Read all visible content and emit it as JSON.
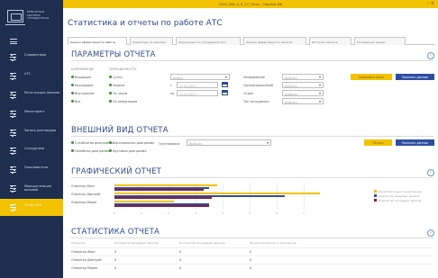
{
  "window": {
    "title": "2021_NW_4_0_27_T.exe - Сартма АФ",
    "controls": "– ×"
  },
  "sidebar": {
    "logo_text": "РЕМОНТНАЯ СИСТЕМА ГРАЖДАНСКАЯ",
    "items": [
      {
        "label": "Справочники"
      },
      {
        "label": "АТС"
      },
      {
        "label": "Регистрация звонков"
      },
      {
        "label": "Мониторинг"
      },
      {
        "label": "Запись разговоров"
      },
      {
        "label": "Сотрудники"
      },
      {
        "label": "Пользователи"
      },
      {
        "label": "Маршрутизация вызовов"
      },
      {
        "label": "Отчёт АТС"
      }
    ]
  },
  "page": {
    "title": "Статистика и отчеты по работе АТС",
    "tabs": [
      "Оценка эффективности работы",
      "Операторы по звонкам",
      "Загруженность сотрудников АТС",
      "Оценка эффективности звонков",
      "Источник звонков",
      "Потерянные звонки"
    ]
  },
  "params": {
    "title": "ПАРАМЕТРЫ ОТЧЕТА",
    "col1_header": "НАПРАВЛЕНИЕ",
    "col2_header": "ПЕРИОДИЧНОСТЬ",
    "col1_items": [
      "Входящие",
      "Исходящие",
      "Внутренние",
      "Все"
    ],
    "col2_items": [
      "Сутки",
      "Неделя",
      "По часам",
      "По операторам"
    ],
    "period_placeholder": "Выбор",
    "from_label": "с",
    "to_label": "по",
    "date_from": "01.01.2021",
    "date_to": "31.01.2021",
    "right_labels": [
      "Направление",
      "Организационный",
      "Отдел",
      "Тип сотрудника"
    ],
    "right_placeholder": "Выбрать",
    "btn_save": "Сохранить отчет",
    "btn_show": "Показать данные"
  },
  "view": {
    "title": "ВНЕШНИЙ ВИД ОТЧЕТА",
    "checks": [
      "Столбчатая диаграмма",
      "Вертикальная диаграмма",
      "Линейная диаграмма",
      "Круговая диаграмма"
    ],
    "group_label": "Группировка",
    "group_placeholder": "Выбрать",
    "btn_print": "Печать",
    "btn_show": "Показать данные"
  },
  "chart_section": {
    "title": "ГРАФИЧЕСКИЙ ОТЧЕТ"
  },
  "chart_data": {
    "type": "bar",
    "orientation": "horizontal",
    "categories": [
      "Оператор Иван",
      "Оператор Дмитрий",
      "Оператор Мария"
    ],
    "series": [
      {
        "name": "Продолжительность разговоров",
        "color": "#f3c200",
        "values": [
          3.8,
          7.6,
          2.2
        ]
      },
      {
        "name": "Количество входящих звонков",
        "color": "#2e4ea0",
        "values": [
          3.5,
          6.3,
          3.5
        ]
      },
      {
        "name": "Количество исходящих звонков",
        "color": "#8b1a3a",
        "values": [
          3.3,
          3.6,
          3.5
        ]
      }
    ],
    "x_ticks": [
      "0",
      "1",
      "2",
      "3",
      "4",
      "5",
      "6",
      "7"
    ],
    "xlim": [
      0,
      8.4
    ],
    "legend_position": "right",
    "grid": true
  },
  "stats": {
    "title": "СТАТИСТИКА ОТЧЕТА",
    "headers": [
      "Оператор",
      "Количество входящих звонков",
      "Количество исходящих звонков",
      "Продолжительность разговоров"
    ],
    "rows": [
      [
        "Оператор Иван",
        "0",
        "0",
        "0"
      ],
      [
        "Оператор Дмитрий",
        "0",
        "0",
        "0"
      ],
      [
        "Оператор Мария",
        "0",
        "0",
        "0"
      ]
    ]
  },
  "colors": {
    "accent": "#f3c200",
    "sidebar": "#1e2e4f",
    "primary": "#2e4ea0",
    "heading": "#2f4a86"
  }
}
